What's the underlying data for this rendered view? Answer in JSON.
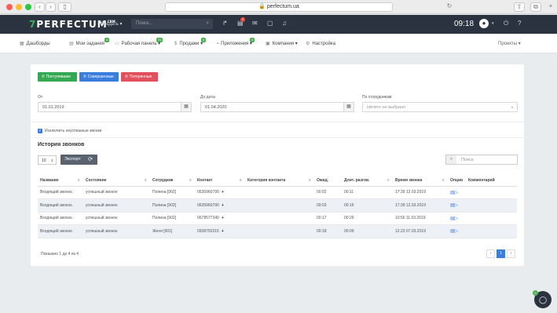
{
  "browser": {
    "url": "perfectum.ua"
  },
  "topbar": {
    "logo_text": "PERFECTUM",
    "logo_seven": "7",
    "logo_sup": "CRM",
    "create_label": "Создать ▾",
    "search_placeholder": "Поиск...",
    "notif_count": "7",
    "time": "09:18"
  },
  "nav": {
    "items": [
      {
        "label": "Дашборды",
        "badge": ""
      },
      {
        "label": "Мои задания",
        "badge": "4"
      },
      {
        "label": "Рабочая панель ▾",
        "badge": "21"
      },
      {
        "label": "Продажи ▾",
        "badge": "4"
      },
      {
        "label": "Приложения ▾",
        "badge": "3"
      },
      {
        "label": "Компания ▾",
        "badge": ""
      },
      {
        "label": "Настройка",
        "badge": ""
      }
    ],
    "projects": "Проекты ▾"
  },
  "buttons": {
    "incoming": "Поступившие",
    "made": "Совершенные",
    "missed": "Потерянные"
  },
  "filters": {
    "from_label": "От",
    "from_value": "01.01.2019",
    "to_label": "До даты",
    "to_value": "01.04.2020",
    "employee_label": "По сотрудникам",
    "employee_placeholder": "Ничего не выбрано",
    "exclude_label": "Исключить неуспешные звонки"
  },
  "history": {
    "title": "История звонков",
    "page_size": "10",
    "export_label": "Экспорт",
    "search_placeholder": "Поиск:",
    "columns": [
      "Название",
      "Состояние",
      "Сотрудник",
      "Контакт",
      "Категория контакта",
      "Ожид.",
      "Длит. разгов.",
      "Время звонка",
      "Опции",
      "Комментарий"
    ],
    "rows": [
      {
        "name": "Входящий звонок.",
        "state": "успешный звонок",
        "employee": "Полина [902]",
        "contact": "0635960790",
        "category": "",
        "wait": "00:02",
        "duration": "00:11",
        "time": "17:39 12.03.2019",
        "comment": ""
      },
      {
        "name": "Входящий звонок.",
        "state": "успешный звонок",
        "employee": "Полина [902]",
        "contact": "0635960790",
        "category": "",
        "wait": "00:03",
        "duration": "00:16",
        "time": "17:39 12.03.2019",
        "comment": ""
      },
      {
        "name": "Входящий звонок.",
        "state": "успешный звонок",
        "employee": "Полина [902]",
        "contact": "0678577340",
        "category": "",
        "wait": "00:17",
        "duration": "00:29",
        "time": "10:56 11.03.2019",
        "comment": ""
      },
      {
        "name": "Входящий звонок.",
        "state": "успешный звонок",
        "employee": "Женя [901]",
        "contact": "0938793315",
        "category": "",
        "wait": "00:18",
        "duration": "00:09",
        "time": "12:23 07.03.2019",
        "comment": ""
      }
    ],
    "shown_text": "Показано 1 до 4 из 4",
    "pager": {
      "prev": "‹",
      "current": "1",
      "next": "›"
    }
  },
  "chat": {
    "badge": "0"
  },
  "colors": {
    "incoming": "#34a853",
    "made": "#3b7ddd",
    "missed": "#e2505e",
    "topbar": "#2b3340"
  }
}
